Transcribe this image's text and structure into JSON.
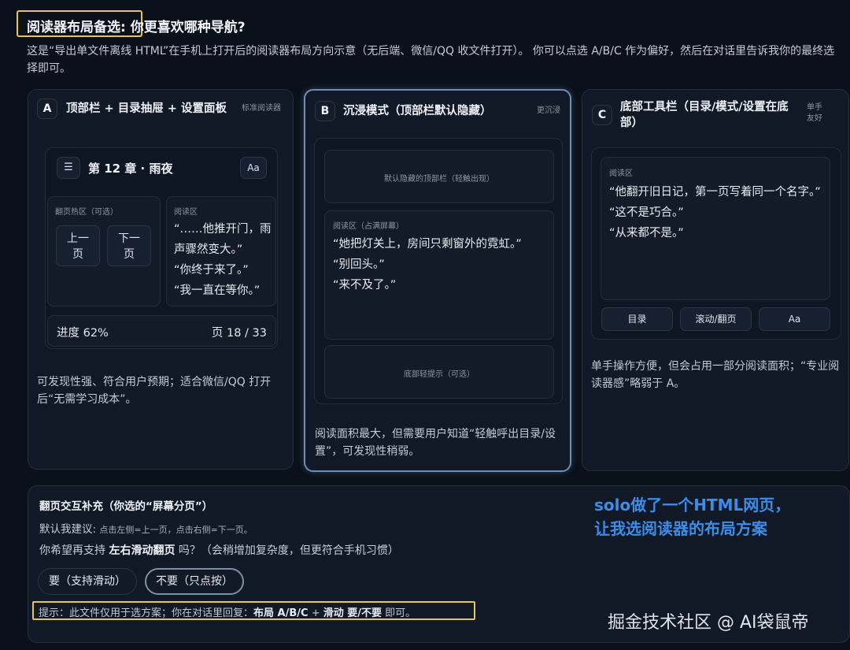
{
  "header": {
    "title_highlight": "阅读器布局备选:",
    "title_question": "你更喜欢哪种导航?",
    "description": "这是“导出单文件离线 HTML”在手机上打开后的阅读器布局方向示意（无后端、微信/QQ 收文件打开）。 你可以点选 A/B/C 作为偏好，然后在对话里告诉我你的最终选择即可。"
  },
  "cards": {
    "a": {
      "letter": "A",
      "title": "顶部栏 + 目录抽屉 + 设置面板",
      "tag": "标准阅读器",
      "chapter": "第 12 章 · 雨夜",
      "menu_icon": "☰",
      "font_button": "Aa",
      "page_zone_label": "翻页热区（可选）",
      "prev_button": "上一页",
      "next_button": "下一页",
      "reading_label": "阅读区",
      "quotes": [
        "“……他推开门，雨声骤然变大。”",
        "“你终于来了。”",
        "“我一直在等你。”"
      ],
      "progress": "进度 62%",
      "page": "页 18 / 33",
      "description": "可发现性强、符合用户预期；适合微信/QQ 打开后“无需学习成本”。"
    },
    "b": {
      "letter": "B",
      "title": "沉浸模式（顶部栏默认隐藏）",
      "tag": "更沉浸",
      "top_hint": "默认隐藏的顶部栏（轻触出现）",
      "reading_label": "阅读区（占满屏幕）",
      "quotes": [
        "“她把灯关上，房间只剩窗外的霓虹。”",
        "“别回头。”",
        "“来不及了。”"
      ],
      "bottom_hint": "底部轻提示（可选）",
      "description": "阅读面积最大，但需要用户知道“轻触呼出目录/设置”，可发现性稍弱。"
    },
    "c": {
      "letter": "C",
      "title": "底部工具栏（目录/模式/设置在底部）",
      "tag": "单手友好",
      "reading_label": "阅读区",
      "quotes": [
        "“他翻开旧日记，第一页写着同一个名字。”",
        "“这不是巧合。”",
        "“从来都不是。”"
      ],
      "toolbar": [
        "目录",
        "滚动/翻页",
        "Aa"
      ],
      "description": "单手操作方便，但会占用一部分阅读面积；“专业阅读器感”略弱于 A。"
    }
  },
  "page_turn": {
    "title": "翻页交互补充（你选的“屏幕分页”）",
    "suggestion_label": "默认我建议:",
    "suggestion_detail": "点击左侧=上一页，点击右侧=下一页。",
    "question_prefix": "你希望再支持",
    "question_bold": "左右滑动翻页",
    "question_suffix": "吗？（会稍增加复杂度，但更符合手机习惯）",
    "option_yes": "要（支持滑动）",
    "option_no": "不要（只点按）",
    "tip_prefix": "提示：此文件仅用于选方案；你在对话里回复：",
    "tip_bold1": "布局 A/B/C",
    "tip_plus": " + ",
    "tip_bold2": "滑动 要/不要",
    "tip_suffix": " 即可。"
  },
  "annotation": {
    "line1": "solo做了一个HTML网页，",
    "line2": "让我选阅读器的布局方案"
  },
  "watermark": "掘金技术社区 @ AI袋鼠帝",
  "colors": {
    "highlight": "#e8c25a",
    "annotation": "#3c8ce8",
    "selected_border": "#6d8fb7",
    "background": "#0b111b"
  }
}
